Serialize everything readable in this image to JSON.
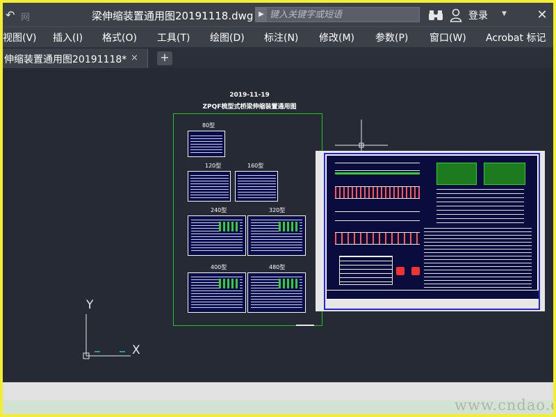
{
  "titlebar": {
    "logo_text": "网",
    "document_title": "梁伸缩装置通用图20191118.dwg",
    "search_placeholder": "键入关键字或短语",
    "login_label": "登录"
  },
  "menu": {
    "items": [
      "视图(V)",
      "插入(I)",
      "格式(O)",
      "工具(T)",
      "绘图(D)",
      "标注(N)",
      "修改(M)",
      "参数(P)",
      "窗口(W)",
      "Acrobat 标记"
    ]
  },
  "tabs": {
    "active_label": "伸缩装置通用图20191118*",
    "close_glyph": "×",
    "new_tab_glyph": "+"
  },
  "drawing": {
    "date": "2019-11-19",
    "title": "ZPQF梳型式桥梁伸缩装置通用图",
    "sheet_labels": [
      "80型",
      "120型",
      "160型",
      "240型",
      "320型",
      "400型",
      "480型"
    ]
  },
  "ucs": {
    "y_label": "Y",
    "x_label": "X"
  },
  "watermark": "www.cndao.com",
  "colors": {
    "canvas": "#252a35",
    "chrome": "#3c4049",
    "frame": "#f2ee35",
    "green_frame": "#26c226",
    "blue_frame": "#2222dd"
  }
}
